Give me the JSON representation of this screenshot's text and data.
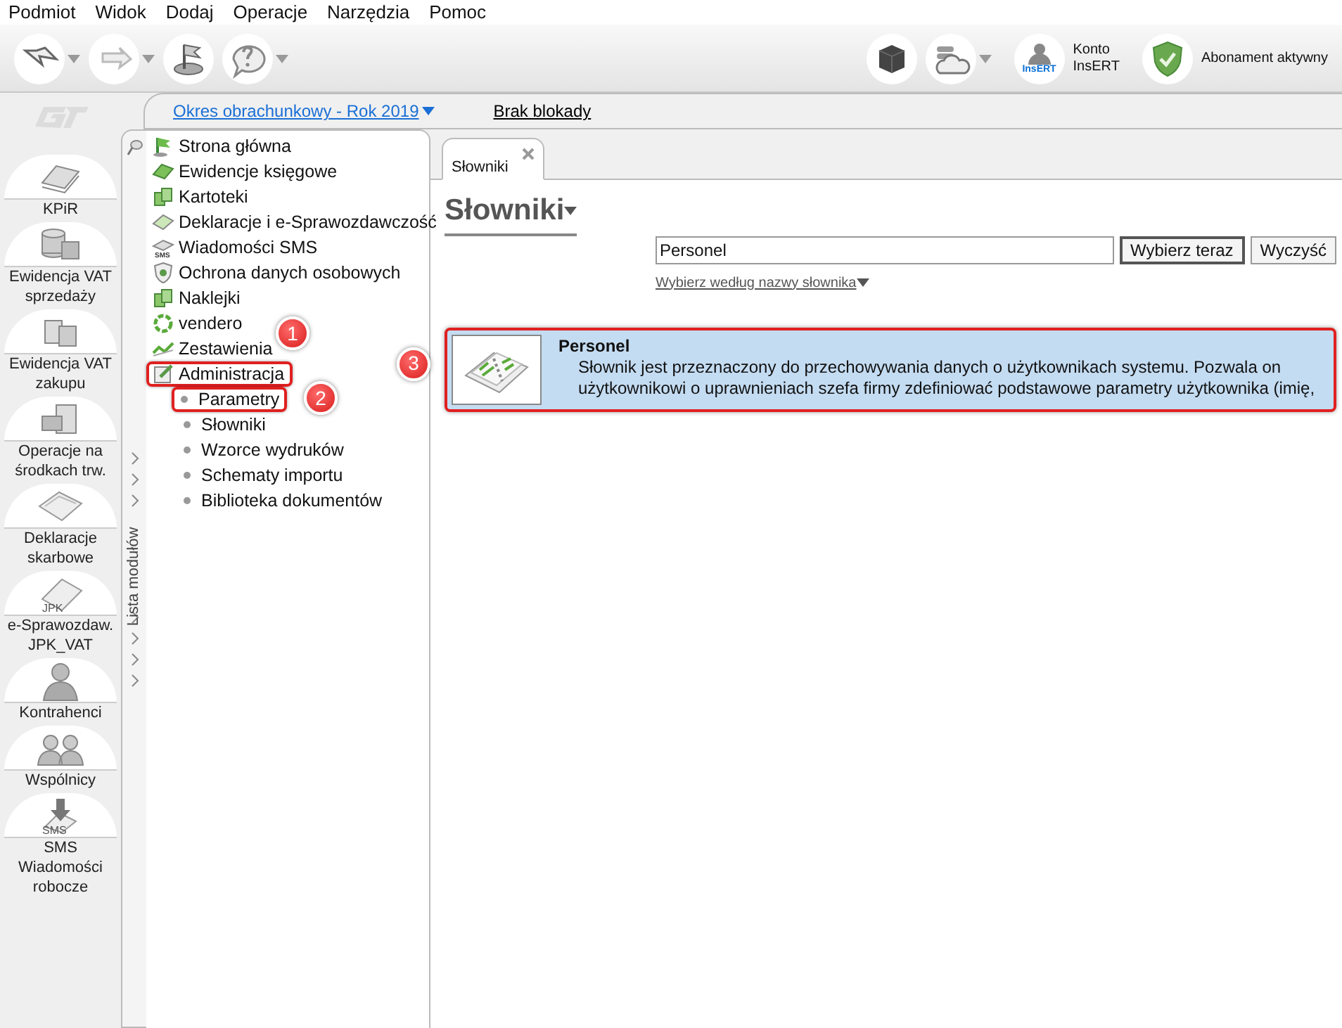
{
  "menu": [
    "Podmiot",
    "Widok",
    "Dodaj",
    "Operacje",
    "Narzędzia",
    "Pomoc"
  ],
  "toolbar": {
    "left": [
      {
        "kind": "back",
        "dropdown": true
      },
      {
        "kind": "forward",
        "dropdown": true
      },
      {
        "kind": "flag",
        "dropdown": false
      },
      {
        "kind": "help",
        "dropdown": true
      }
    ],
    "account": {
      "lines": [
        "Konto",
        "InsERT"
      ],
      "badge": "InsERT"
    },
    "subscription": "Abonament aktywny"
  },
  "header": {
    "period": "Okres obrachunkowy - Rok 2019",
    "lock": "Brak blokady"
  },
  "modules": [
    {
      "kind": "book",
      "lines": [
        "KPiR"
      ]
    },
    {
      "kind": "coins",
      "lines": [
        "Ewidencja VAT",
        "sprzedaży"
      ]
    },
    {
      "kind": "boxes",
      "lines": [
        "Ewidencja VAT",
        "zakupu"
      ]
    },
    {
      "kind": "cabinet",
      "lines": [
        "Operacje na",
        "środkach trw."
      ]
    },
    {
      "kind": "papers",
      "lines": [
        "Deklaracje",
        "skarbowe"
      ]
    },
    {
      "kind": "jpk",
      "lines": [
        "e-Sprawozdaw.",
        "JPK_VAT"
      ],
      "icon_text": "JPK"
    },
    {
      "kind": "person",
      "lines": [
        "Kontrahenci"
      ]
    },
    {
      "kind": "people",
      "lines": [
        "Wspólnicy"
      ]
    },
    {
      "kind": "sms",
      "lines": [
        "SMS",
        "Wiadomości",
        "robocze"
      ],
      "icon_text": "SMS"
    }
  ],
  "module_list_label": "Lista modułów",
  "tree": [
    {
      "label": "Strona główna",
      "annotated": false
    },
    {
      "label": "Ewidencje księgowe",
      "annotated": false
    },
    {
      "label": "Kartoteki",
      "annotated": false
    },
    {
      "label": "Deklaracje i e-Sprawozdawczość",
      "annotated": false
    },
    {
      "label": "Wiadomości SMS",
      "icon_text": "SMS",
      "annotated": false
    },
    {
      "label": "Ochrona danych osobowych",
      "annotated": false
    },
    {
      "label": "Naklejki",
      "annotated": false
    },
    {
      "label": "vendero",
      "annotated": false
    },
    {
      "label": "Zestawienia",
      "annotated": false
    },
    {
      "label": "Administracja",
      "annotated": true,
      "callout": "1",
      "children": [
        {
          "label": "Parametry",
          "annotated": true,
          "callout": "2"
        },
        {
          "label": "Słowniki",
          "annotated": false
        },
        {
          "label": "Wzorce wydruków",
          "annotated": false
        },
        {
          "label": "Schematy importu",
          "annotated": false
        },
        {
          "label": "Biblioteka dokumentów",
          "annotated": false
        }
      ]
    }
  ],
  "tabs": [
    {
      "label": "Słowniki",
      "selected": true,
      "closable": true
    }
  ],
  "page_title": "Słowniki",
  "search": {
    "value": "Personel",
    "buttons": [
      "Wybierz teraz",
      "Wyczyść"
    ],
    "filter": "Wybierz według nazwy słownika"
  },
  "results": [
    {
      "title": "Personel",
      "description": "Słownik jest przeznaczony do przechowywania danych o użytkownikach systemu. Pozwala on użytkownikowi o uprawnieniach szefa firmy zdefiniować podstawowe parametry użytkownika (imię,",
      "selected": true,
      "annotated": true,
      "callout": "3"
    }
  ]
}
